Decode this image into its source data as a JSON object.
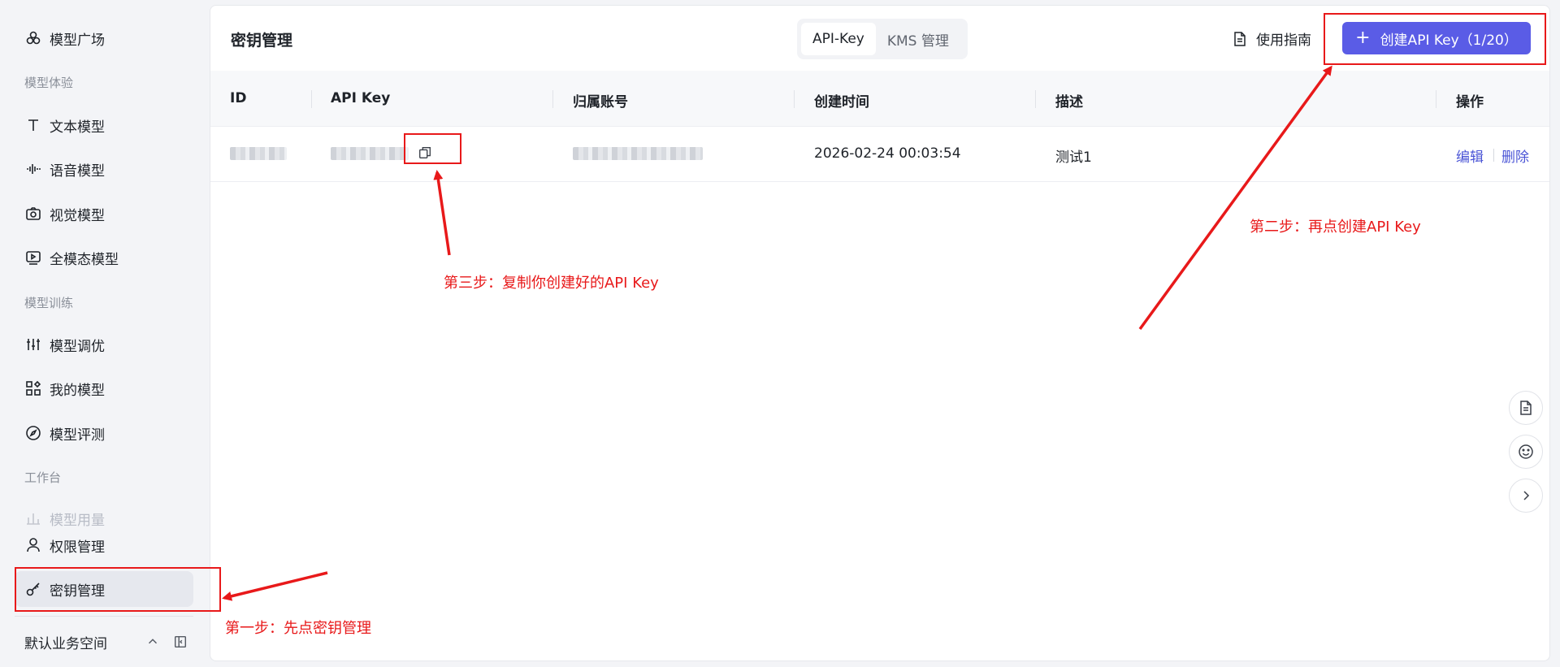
{
  "sidebar": {
    "items": [
      {
        "label": "模型广场",
        "icon": "model-square-icon"
      },
      {
        "label": "文本模型",
        "icon": "text-icon"
      },
      {
        "label": "语音模型",
        "icon": "waveform-icon"
      },
      {
        "label": "视觉模型",
        "icon": "camera-icon"
      },
      {
        "label": "全模态模型",
        "icon": "video-icon"
      },
      {
        "label": "模型调优",
        "icon": "sliders-icon"
      },
      {
        "label": "我的模型",
        "icon": "apps-icon"
      },
      {
        "label": "模型评测",
        "icon": "compass-icon"
      },
      {
        "label": "模型用量",
        "icon": "bar-chart-icon"
      },
      {
        "label": "权限管理",
        "icon": "user-icon"
      },
      {
        "label": "密钥管理",
        "icon": "key-icon"
      }
    ],
    "groups": [
      "模型体验",
      "模型训练",
      "工作台"
    ],
    "workspace": "默认业务空间"
  },
  "header": {
    "title": "密钥管理",
    "tabs": [
      {
        "label": "API-Key",
        "active": true
      },
      {
        "label": "KMS 管理",
        "active": false
      }
    ],
    "guide_label": "使用指南",
    "create_label": "创建API Key（1/20）",
    "accent_color": "#5a5ce6"
  },
  "table": {
    "columns": [
      "ID",
      "API Key",
      "归属账号",
      "创建时间",
      "描述",
      "操作"
    ],
    "rows": [
      {
        "created": "2026-02-24 00:03:54",
        "description": "测试1",
        "actions": [
          "编辑",
          "删除"
        ]
      }
    ]
  },
  "annotations": {
    "step1": "第一步：先点密钥管理",
    "step2": "第二步：再点创建API Key",
    "step3": "第三步：复制你创建好的API Key",
    "color": "#e8191a"
  }
}
